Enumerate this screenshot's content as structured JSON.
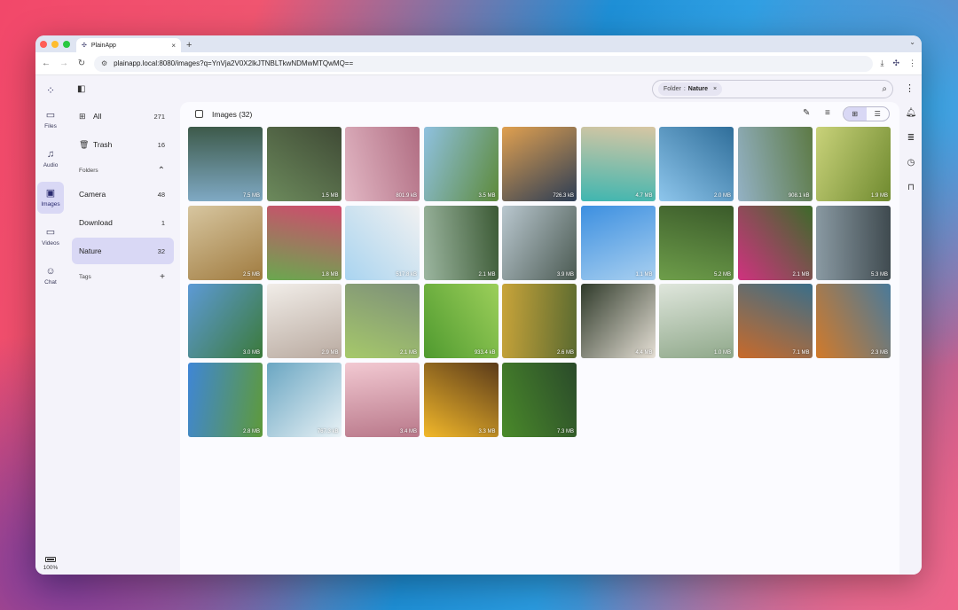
{
  "browser": {
    "tab_title": "PlainApp",
    "tab_close": "×",
    "new_tab": "+",
    "url": "plainapp.local:8080/images?q=YnVja2V0X2lkJTNBLTkwNDMwMTQwMQ=="
  },
  "rail": {
    "items": [
      {
        "label": "Files",
        "icon": "folder-icon"
      },
      {
        "label": "Audio",
        "icon": "music-note-icon"
      },
      {
        "label": "Images",
        "icon": "image-icon"
      },
      {
        "label": "Videos",
        "icon": "video-camera-icon"
      },
      {
        "label": "Chat",
        "icon": "chat-bot-icon"
      }
    ],
    "battery": "100%"
  },
  "sidebar": {
    "all": {
      "label": "All",
      "count": "271"
    },
    "trash": {
      "label": "Trash",
      "count": "16"
    },
    "folders_heading": "Folders",
    "folders": [
      {
        "label": "Camera",
        "count": "48"
      },
      {
        "label": "Download",
        "count": "1"
      },
      {
        "label": "Nature",
        "count": "32"
      }
    ],
    "tags_heading": "Tags",
    "tags_action": "+"
  },
  "search": {
    "chip_key": "Folder",
    "chip_sep": ":",
    "chip_value": "Nature",
    "chip_remove": "×",
    "placeholder": ""
  },
  "main": {
    "title": "Images (32)"
  },
  "images": [
    {
      "size": "7.5 MB",
      "c1": "#7fa9c4",
      "c2": "#3d5a4a"
    },
    {
      "size": "1.5 MB",
      "c1": "#6c8a5c",
      "c2": "#3f4a35"
    },
    {
      "size": "801.9 kB",
      "c1": "#e2b7c4",
      "c2": "#b06d82"
    },
    {
      "size": "3.5 MB",
      "c1": "#8fc1e0",
      "c2": "#5d8a3a"
    },
    {
      "size": "726.3 kB",
      "c1": "#e0a050",
      "c2": "#2c3d55"
    },
    {
      "size": "4.7 MB",
      "c1": "#3fb6b0",
      "c2": "#d7c6a3"
    },
    {
      "size": "2.0 MB",
      "c1": "#8ec6ec",
      "c2": "#2f6e9a"
    },
    {
      "size": "908.1 kB",
      "c1": "#93b1c4",
      "c2": "#5d7a45"
    },
    {
      "size": "1.9 MB",
      "c1": "#c9d27a",
      "c2": "#6f8a2f"
    },
    {
      "size": "2.5 MB",
      "c1": "#d7c6a0",
      "c2": "#a07b3f"
    },
    {
      "size": "1.8 MB",
      "c1": "#6aa84f",
      "c2": "#d04a6e"
    },
    {
      "size": "517.8 kB",
      "c1": "#a9d4f0",
      "c2": "#f1f1f1"
    },
    {
      "size": "2.1 MB",
      "c1": "#9cb6a0",
      "c2": "#3c5a35"
    },
    {
      "size": "3.9 MB",
      "c1": "#b9c7cf",
      "c2": "#4b5a52"
    },
    {
      "size": "1.1 MB",
      "c1": "#3c8fe0",
      "c2": "#a9d0f0"
    },
    {
      "size": "5.2 MB",
      "c1": "#6e9e4a",
      "c2": "#3a5a2a"
    },
    {
      "size": "2.1 MB",
      "c1": "#d0327f",
      "c2": "#3d6a2a"
    },
    {
      "size": "5.3 MB",
      "c1": "#8a9aa3",
      "c2": "#3f4a4f"
    },
    {
      "size": "3.0 MB",
      "c1": "#5d9ad6",
      "c2": "#3b7a3a"
    },
    {
      "size": "2.9 MB",
      "c1": "#f1ede8",
      "c2": "#b9aaa0"
    },
    {
      "size": "2.1 MB",
      "c1": "#a6c96a",
      "c2": "#7d8f7a"
    },
    {
      "size": "933.4 kB",
      "c1": "#4f9a2f",
      "c2": "#9ccf5a"
    },
    {
      "size": "2.6 MB",
      "c1": "#c9a43a",
      "c2": "#5a6a30"
    },
    {
      "size": "4.4 MB",
      "c1": "#2f3a2a",
      "c2": "#e6e0d6"
    },
    {
      "size": "1.0 MB",
      "c1": "#dfe6dc",
      "c2": "#8fa88a"
    },
    {
      "size": "7.1 MB",
      "c1": "#c96a2a",
      "c2": "#3a6e8a"
    },
    {
      "size": "2.3 MB",
      "c1": "#d27a2a",
      "c2": "#4a7a9a"
    },
    {
      "size": "2.8 MB",
      "c1": "#3f86d6",
      "c2": "#5e9a3a"
    },
    {
      "size": "767.3 kB",
      "c1": "#6aa6c2",
      "c2": "#e9f2f6"
    },
    {
      "size": "3.4 MB",
      "c1": "#f2c9d2",
      "c2": "#b9788a"
    },
    {
      "size": "3.3 MB",
      "c1": "#f2b82a",
      "c2": "#5a3a1a"
    },
    {
      "size": "7.3 MB",
      "c1": "#4a8a2a",
      "c2": "#2a4a2a"
    }
  ]
}
